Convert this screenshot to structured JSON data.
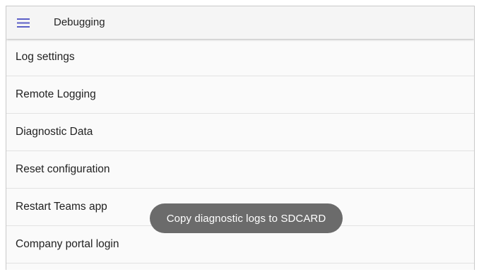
{
  "app_bar": {
    "title": "Debugging",
    "menu_icon": "hamburger-menu-icon",
    "accent_color": "#5b5fc7"
  },
  "menu_items": [
    {
      "label": "Log settings"
    },
    {
      "label": "Remote Logging"
    },
    {
      "label": "Diagnostic Data"
    },
    {
      "label": "Reset configuration"
    },
    {
      "label": "Restart Teams app"
    },
    {
      "label": "Company portal login"
    }
  ],
  "toast": {
    "message": "Copy diagnostic logs to SDCARD"
  }
}
